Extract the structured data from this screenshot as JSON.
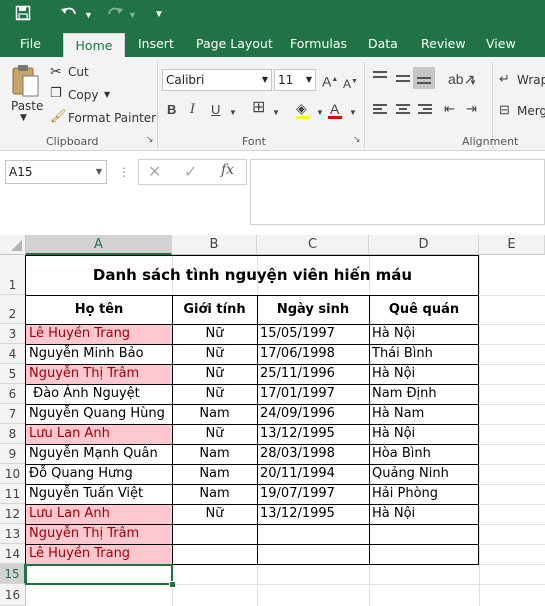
{
  "quick_access": {
    "save_icon": "save-icon",
    "undo_icon": "undo-icon",
    "redo_icon": "redo-icon",
    "customize_icon": "customize-icon"
  },
  "tabs": [
    "File",
    "Home",
    "Insert",
    "Page Layout",
    "Formulas",
    "Data",
    "Review",
    "View"
  ],
  "active_tab": "Home",
  "clipboard": {
    "paste": "Paste",
    "cut": "Cut",
    "copy": "Copy",
    "format_painter": "Format Painter",
    "group": "Clipboard"
  },
  "font": {
    "name": "Calibri",
    "size": "11",
    "bold": "B",
    "italic": "I",
    "underline": "U",
    "group": "Font"
  },
  "alignment": {
    "wrap": "Wrap",
    "merge": "Merg",
    "group": "Alignment"
  },
  "formula_bar": {
    "name_box": "A15",
    "fx": "fx",
    "value": ""
  },
  "columns": [
    "A",
    "B",
    "C",
    "D",
    "E"
  ],
  "rows": [
    "1",
    "2",
    "3",
    "4",
    "5",
    "6",
    "7",
    "8",
    "9",
    "10",
    "11",
    "12",
    "13",
    "14",
    "15",
    "16"
  ],
  "sheet": {
    "title": "Danh sách tình nguyện viên hiến máu",
    "headers": [
      "Họ tên",
      "Giới tính",
      "Ngày sinh",
      "Quê quán"
    ],
    "data": [
      [
        "Lê Huyền Trang",
        "Nữ",
        "15/05/1997",
        "Hà Nội"
      ],
      [
        "Nguyễn Minh Bảo",
        "Nữ",
        "17/06/1998",
        "Thái Bình"
      ],
      [
        "Nguyễn Thị Trâm",
        "Nữ",
        "25/11/1996",
        "Hà Nội"
      ],
      [
        " Đào Ánh Nguyệt",
        "Nữ",
        "17/01/1997",
        "Nam Định"
      ],
      [
        "Nguyễn Quang Hùng",
        "Nam",
        "24/09/1996",
        "Hà Nam"
      ],
      [
        "Lưu Lan Anh",
        "Nữ",
        "13/12/1995",
        "Hà Nội"
      ],
      [
        "Nguyễn Mạnh Quân",
        "Nam",
        "28/03/1998",
        "Hòa Bình"
      ],
      [
        "Đỗ Quang Hưng",
        "Nam",
        "20/11/1994",
        "Quảng Ninh"
      ],
      [
        "Nguyễn Tuấn Việt",
        "Nam",
        "19/07/1997",
        "Hải Phòng"
      ],
      [
        "Lưu Lan Anh",
        "Nữ",
        "13/12/1995",
        "Hà Nội"
      ],
      [
        "Nguyễn Thị Trâm",
        "",
        "",
        ""
      ],
      [
        "Lê Huyền Trang",
        "",
        "",
        ""
      ]
    ],
    "highlighted_rows": [
      3,
      5,
      8,
      12,
      13,
      14
    ],
    "highlight_color": "#ffc7ce",
    "highlight_text_color": "#9c0006",
    "selected_cell": "A15"
  },
  "colors": {
    "excel_green": "#217346",
    "ribbon_bg": "#f3f3f3"
  }
}
